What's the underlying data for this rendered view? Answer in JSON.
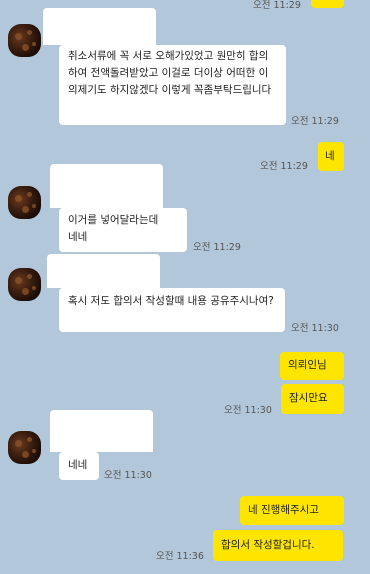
{
  "messages": [
    {
      "side": "right",
      "text": "",
      "time": "오전 11:29"
    },
    {
      "side": "left",
      "text": "취소서류에 꼭 서로 오해가있었고 원만히 합의하여 전액돌려받았고 이걸로 더이상 어떠한 이의제기도 하지않겠다 이렇게 꼭좀부탁드립니다",
      "time": "오전 11:29"
    },
    {
      "side": "right",
      "text": "네",
      "time": "오전 11:29"
    },
    {
      "side": "left",
      "text": "이거를 넣어달라는데\n네네",
      "time": "오전 11:29"
    },
    {
      "side": "left",
      "text": "혹시 저도 합의서 작성할때 내용 공유주시나여?",
      "time": "오전 11:30"
    },
    {
      "side": "right",
      "text": "의뢰인님",
      "time": ""
    },
    {
      "side": "right",
      "text": "잠시만요",
      "time": "오전 11:30"
    },
    {
      "side": "left",
      "text": "네네",
      "time": "오전 11:30"
    },
    {
      "side": "right",
      "text": "네 진행해주시고",
      "time": ""
    },
    {
      "side": "right",
      "text": "합의서 작성할겁니다.",
      "time": "오전 11:36"
    }
  ],
  "colors": {
    "background": "#b2c7d9",
    "my_bubble": "#fee500",
    "their_bubble": "#ffffff"
  }
}
